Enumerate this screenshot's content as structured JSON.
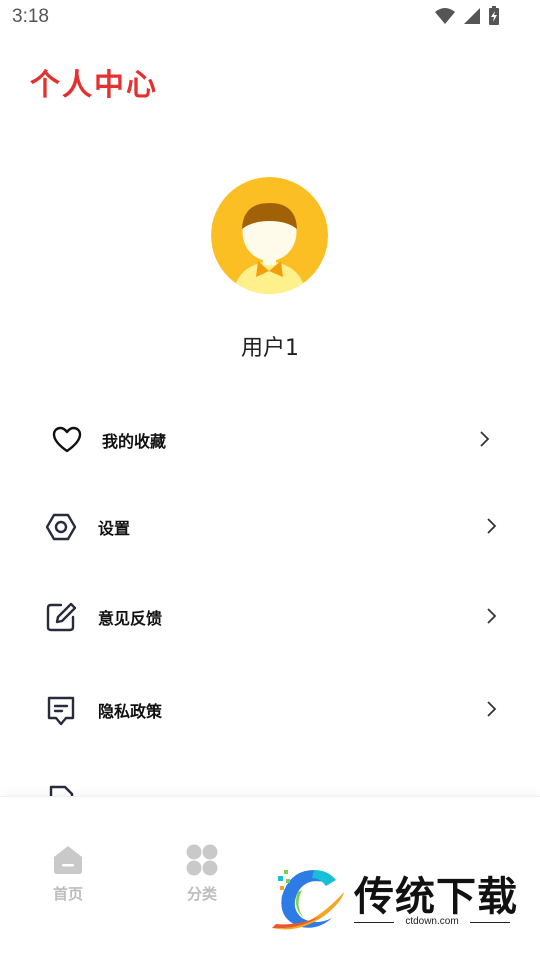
{
  "status_bar": {
    "time": "3:18",
    "icons": [
      "wifi-icon",
      "signal-icon",
      "battery-charging-icon"
    ]
  },
  "page_title": "个人中心",
  "profile": {
    "avatar_colors": {
      "background": "#fbbf24",
      "hair": "#a16207",
      "shirt": "#fef08a",
      "bow": "#f59e0b"
    },
    "username": "用户1"
  },
  "menu": {
    "items": [
      {
        "label": "我的收藏",
        "icon": "heart-icon"
      },
      {
        "label": "设置",
        "icon": "settings-hexagon-icon"
      },
      {
        "label": "意见反馈",
        "icon": "edit-square-icon"
      },
      {
        "label": "隐私政策",
        "icon": "document-message-icon"
      }
    ]
  },
  "bottom_nav": {
    "items": [
      {
        "label": "首页",
        "icon": "home-icon"
      },
      {
        "label": "分类",
        "icon": "category-grid-icon"
      }
    ]
  },
  "watermark": {
    "text": "传统下载",
    "url": "ctdown.com"
  },
  "colors": {
    "accent": "#e3312f",
    "icon_stroke": "#2a2a3e",
    "nav_inactive": "#bdbdbd"
  }
}
